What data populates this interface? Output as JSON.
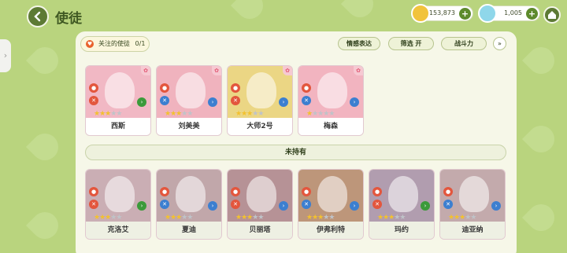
{
  "header": {
    "title": "使徒"
  },
  "resources": {
    "coins": "153,873",
    "gems": "1,005"
  },
  "toolbar": {
    "follow_label": "关注的使徒",
    "follow_count": "0/1",
    "emotion_label": "情感表达",
    "filter_label": "筛选 开",
    "power_label": "战斗力",
    "expand_label": "»"
  },
  "section_unowned": "未持有",
  "owned": [
    {
      "name": "西斯",
      "stars": 3,
      "bg": "#f1b8c4"
    },
    {
      "name": "刘美美",
      "stars": 3,
      "bg": "#f0b3be"
    },
    {
      "name": "大师2号",
      "stars": 3,
      "bg": "#ebd684"
    },
    {
      "name": "梅森",
      "stars": 1,
      "bg": "#f2b4c0"
    }
  ],
  "unowned": [
    {
      "name": "克洛艾",
      "stars": 3,
      "bg": "#e8b9c4"
    },
    {
      "name": "夏迪",
      "stars": 3,
      "bg": "#ddb2b8"
    },
    {
      "name": "贝丽塔",
      "stars": 3,
      "bg": "#d79aa1"
    },
    {
      "name": "伊弗利特",
      "stars": 3,
      "bg": "#e0a070"
    },
    {
      "name": "玛约",
      "stars": 3,
      "bg": "#c8a8c6"
    },
    {
      "name": "迪亚纳",
      "stars": 3,
      "bg": "#e0b6b8"
    }
  ]
}
